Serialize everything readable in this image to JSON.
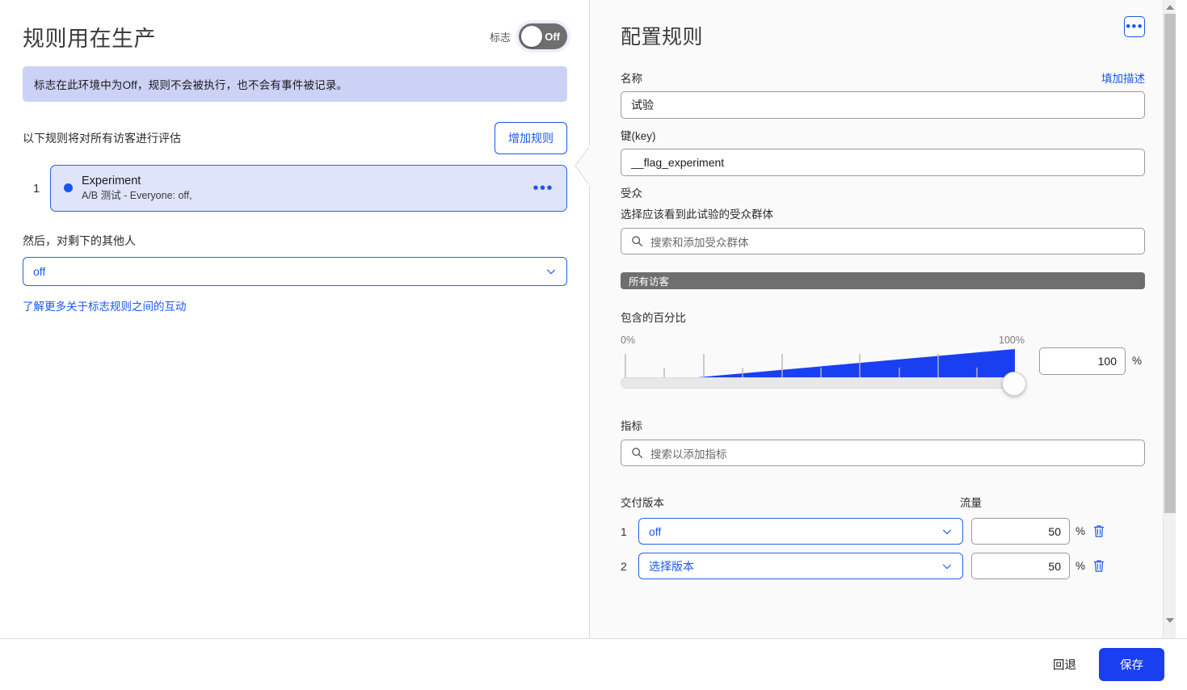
{
  "left": {
    "title": "规则用在生产",
    "flag_toggle": {
      "label": "标志",
      "state": "Off"
    },
    "info_banner": "标志在此环境中为Off，规则不会被执行，也不会有事件被记录。",
    "rules_caption": "以下规则将对所有访客进行评估",
    "add_rule_label": "增加规则",
    "rules": [
      {
        "index": "1",
        "title": "Experiment",
        "subtitle": "A/B 测试 - Everyone: off,",
        "menu": "•••"
      }
    ],
    "then_label": "然后，对剩下的其他人",
    "fallthrough_value": "off",
    "learn_more_link": "了解更多关于标志规则之间的互动"
  },
  "right": {
    "title": "配置规则",
    "menu_icon": "•••",
    "name": {
      "label": "名称",
      "link": "填加描述",
      "value": "试验"
    },
    "key": {
      "label": "键(key)",
      "value": "__flag_experiment"
    },
    "audience": {
      "label": "受众",
      "description": "选择应该看到此试验的受众群体",
      "search_placeholder": "搜索和添加受众群体",
      "group_bar": "所有访客"
    },
    "percentage": {
      "label": "包含的百分比",
      "min_label": "0%",
      "max_label": "100%",
      "value": "100",
      "unit": "%"
    },
    "metrics": {
      "label": "指标",
      "search_placeholder": "搜索以添加指标"
    },
    "variants": {
      "col_variant": "交付版本",
      "col_traffic": "流量",
      "unit": "%",
      "rows": [
        {
          "index": "1",
          "variant": "off",
          "traffic": "50"
        },
        {
          "index": "2",
          "variant": "选择版本",
          "traffic": "50"
        }
      ]
    }
  },
  "footer": {
    "revert_label": "回退",
    "save_label": "保存"
  },
  "colors": {
    "accent_blue": "#1a56f0",
    "primary_button": "#1a3ff0",
    "banner_bg": "#ccd2f6",
    "rule_card_bg": "#dfe4fb",
    "slider_fill": "#1a3ff0",
    "group_bar_bg": "#6f6f6f"
  }
}
